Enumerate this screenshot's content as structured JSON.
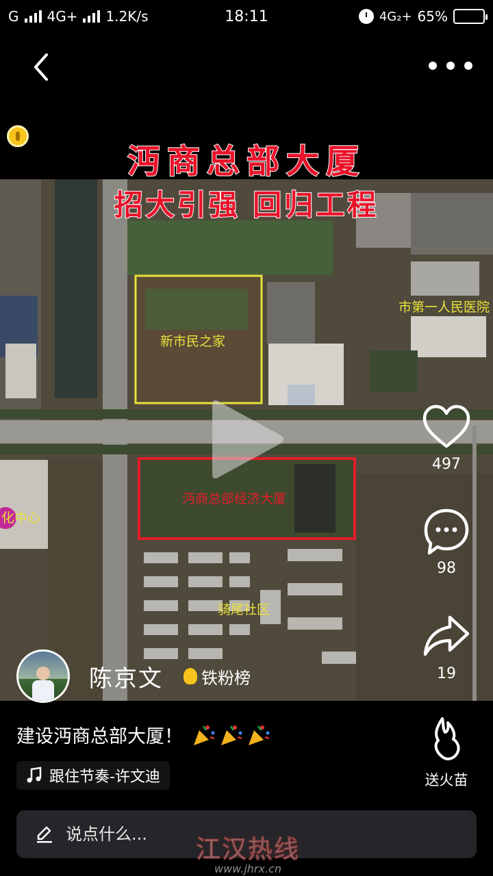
{
  "status_bar": {
    "carrier": "G",
    "network": "4G+",
    "speed": "1.2K/s",
    "time": "18:11",
    "network2": "4G₂+",
    "battery": "65%",
    "battery_level": 0.65
  },
  "video": {
    "title_line1": "沔商总部大厦",
    "title_line2": "招大引强 回归工程",
    "map_labels": {
      "new_citizen_home": "新市民之家",
      "hq_building": "沔商总部经济大厦",
      "hospital": "市第一人民医院",
      "culture_center": "化中心",
      "community": "骑尾社区"
    }
  },
  "actions": {
    "likes": "497",
    "comments": "98",
    "shares": "19"
  },
  "author": {
    "name": "陈京文",
    "badge": "铁粉榜"
  },
  "post": {
    "caption": "建设沔商总部大厦！",
    "music": "跟住节奏-许文迪"
  },
  "gift": {
    "label": "送火苗"
  },
  "comment_bar": {
    "placeholder": "说点什么..."
  },
  "watermark": {
    "name": "江汉热线",
    "url": "www.jhrx.cn"
  },
  "colors": {
    "background": "#000000",
    "title_red": "#e8132a",
    "box_yellow": "#e8e03a",
    "box_red": "#e41c2a",
    "comment_bar": "#26262a"
  }
}
